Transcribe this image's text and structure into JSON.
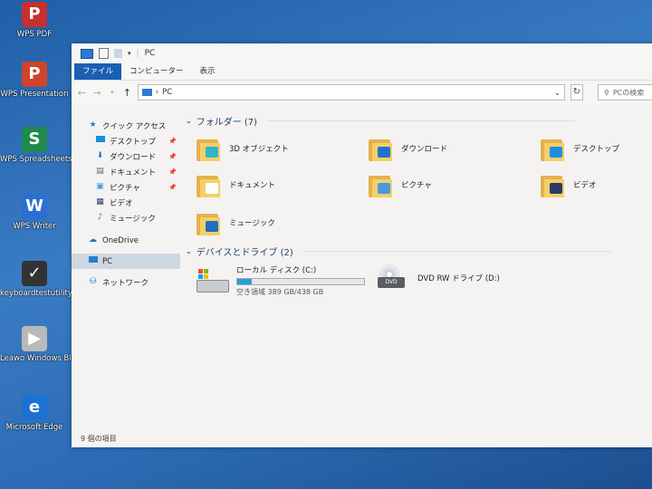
{
  "desktop": {
    "icons": [
      {
        "label": "WPS PDF",
        "color": "#c8302f",
        "glyph": "P"
      },
      {
        "label": "WPS Presentation",
        "color": "#d0442b",
        "glyph": "P"
      },
      {
        "label": "WPS Spreadsheets",
        "color": "#1f8a4c",
        "glyph": "S"
      },
      {
        "label": "WPS Writer",
        "color": "#2c6fd1",
        "glyph": "W"
      },
      {
        "label": "keyboardtestutility",
        "color": "#333333",
        "glyph": "✓"
      },
      {
        "label": "Leawo Windows Blu-ray Player",
        "color": "#b9b9b9",
        "glyph": "▶"
      },
      {
        "label": "Microsoft Edge",
        "color": "#1b72d2",
        "glyph": "e"
      }
    ]
  },
  "window": {
    "title": "PC",
    "ribbon_tabs": [
      "ファイル",
      "コンピューター",
      "表示"
    ],
    "address_path": "PC",
    "search_placeholder": "PCの検索",
    "sidebar": {
      "quick_access": "クイック アクセス",
      "pinned": [
        "デスクトップ",
        "ダウンロード",
        "ドキュメント",
        "ピクチャ"
      ],
      "unpinned": [
        "ビデオ",
        "ミュージック"
      ],
      "onedrive": "OneDrive",
      "pc": "PC",
      "network": "ネットワーク"
    },
    "folders_header": "フォルダー (7)",
    "folders": [
      {
        "name": "3D オブジェクト",
        "badge": "#2fb6c6"
      },
      {
        "name": "ダウンロード",
        "badge": "#1e74c8"
      },
      {
        "name": "デスクトップ",
        "badge": "#1a8fe0"
      },
      {
        "name": "ドキュメント",
        "badge": "#ffffff"
      },
      {
        "name": "ピクチャ",
        "badge": "#4b9ad8"
      },
      {
        "name": "ビデオ",
        "badge": "#2a3a6a"
      },
      {
        "name": "ミュージック",
        "badge": "#1d6fc1"
      }
    ],
    "devices_header": "デバイスとドライブ (2)",
    "drives": [
      {
        "name": "ローカル ディスク (C:)",
        "free_text": "空き領域 389 GB/438 GB",
        "used_fraction": 0.112
      },
      {
        "name": "DVD RW ドライブ (D:)"
      }
    ],
    "status": "9 個の項目"
  }
}
